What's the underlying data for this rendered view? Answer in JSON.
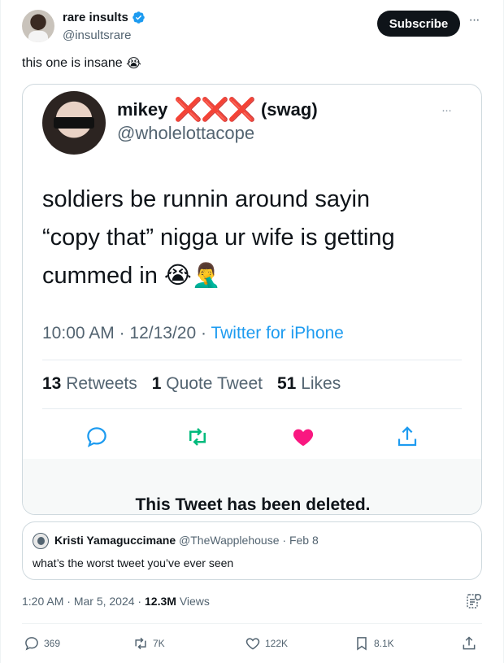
{
  "author": {
    "display_name": "rare insults",
    "handle": "@insultsrare",
    "verified_icon": "verified-badge-icon"
  },
  "subscribe_label": "Subscribe",
  "more_label": "···",
  "post_text": "this one is insane",
  "post_emoji": "😭",
  "screenshot": {
    "name": "mikey",
    "name_marks": "❌❌❌",
    "name_suffix": "(swag)",
    "handle": "@wholelottacope",
    "more": "···",
    "tweet_line1": "soldiers be runnin around sayin",
    "tweet_line2": "“copy that” nigga ur wife is getting",
    "tweet_line3": "cummed in",
    "tweet_emoji": "😭🤦‍♂️",
    "time": "10:00 AM",
    "date": "12/13/20",
    "source": "Twitter for iPhone",
    "retweets_count": "13",
    "retweets_label": "Retweets",
    "quotes_count": "1",
    "quotes_label": "Quote Tweet",
    "likes_count": "51",
    "likes_label": "Likes",
    "deleted_notice": "This Tweet has been deleted.",
    "accent_color": "#1d9bf0",
    "like_color": "#f91880",
    "retweet_color": "#00ba7c"
  },
  "quoted": {
    "name": "Kristi Yamaguccimane",
    "handle": "@TheWapplehouse",
    "date": "Feb 8",
    "text": "what’s the worst tweet you’ve ever seen"
  },
  "meta": {
    "time": "1:20 AM",
    "date": "Mar 5, 2024",
    "views_count": "12.3M",
    "views_label": "Views"
  },
  "actions": {
    "replies": "369",
    "reposts": "7K",
    "likes": "122K",
    "bookmarks": "8.1K"
  }
}
